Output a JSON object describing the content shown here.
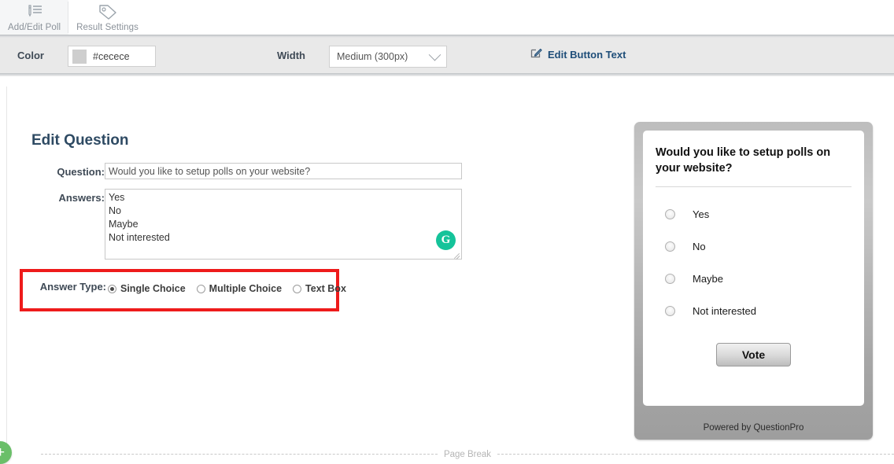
{
  "tabs": [
    {
      "label": "Add/Edit Poll",
      "icon": "pen-lines-icon",
      "active": true
    },
    {
      "label": "Result Settings",
      "icon": "tag-icon",
      "active": false
    }
  ],
  "toolbar": {
    "color_label": "Color",
    "color_value": "#cecece",
    "color_swatch": "#cecece",
    "width_label": "Width",
    "width_value": "Medium (300px)",
    "edit_button_text_link": "Edit Button Text",
    "edit_icon": "edit-square-icon",
    "link_color": "#1f4e79"
  },
  "form": {
    "title": "Edit Question",
    "question_label": "Question:",
    "question_value": "Would you like to setup polls on your website?",
    "answers_label": "Answers:",
    "answers_value": "Yes\nNo\nMaybe\nNot interested",
    "grammarly_icon": "G",
    "answer_type_label": "Answer Type:",
    "answer_types": [
      {
        "label": "Single Choice",
        "checked": true
      },
      {
        "label": "Multiple Choice",
        "checked": false
      },
      {
        "label": "Text Box",
        "checked": false
      }
    ],
    "highlight_color": "#ee1b1b"
  },
  "preview": {
    "question": "Would you like to setup polls on your website?",
    "options": [
      {
        "label": "Yes",
        "selected": false
      },
      {
        "label": "No",
        "selected": false
      },
      {
        "label": "Maybe",
        "selected": false
      },
      {
        "label": "Not interested",
        "selected": false
      }
    ],
    "vote_label": "Vote",
    "footer": "Powered by QuestionPro"
  },
  "footer": {
    "page_break_label": "Page Break",
    "add_label": "+"
  }
}
